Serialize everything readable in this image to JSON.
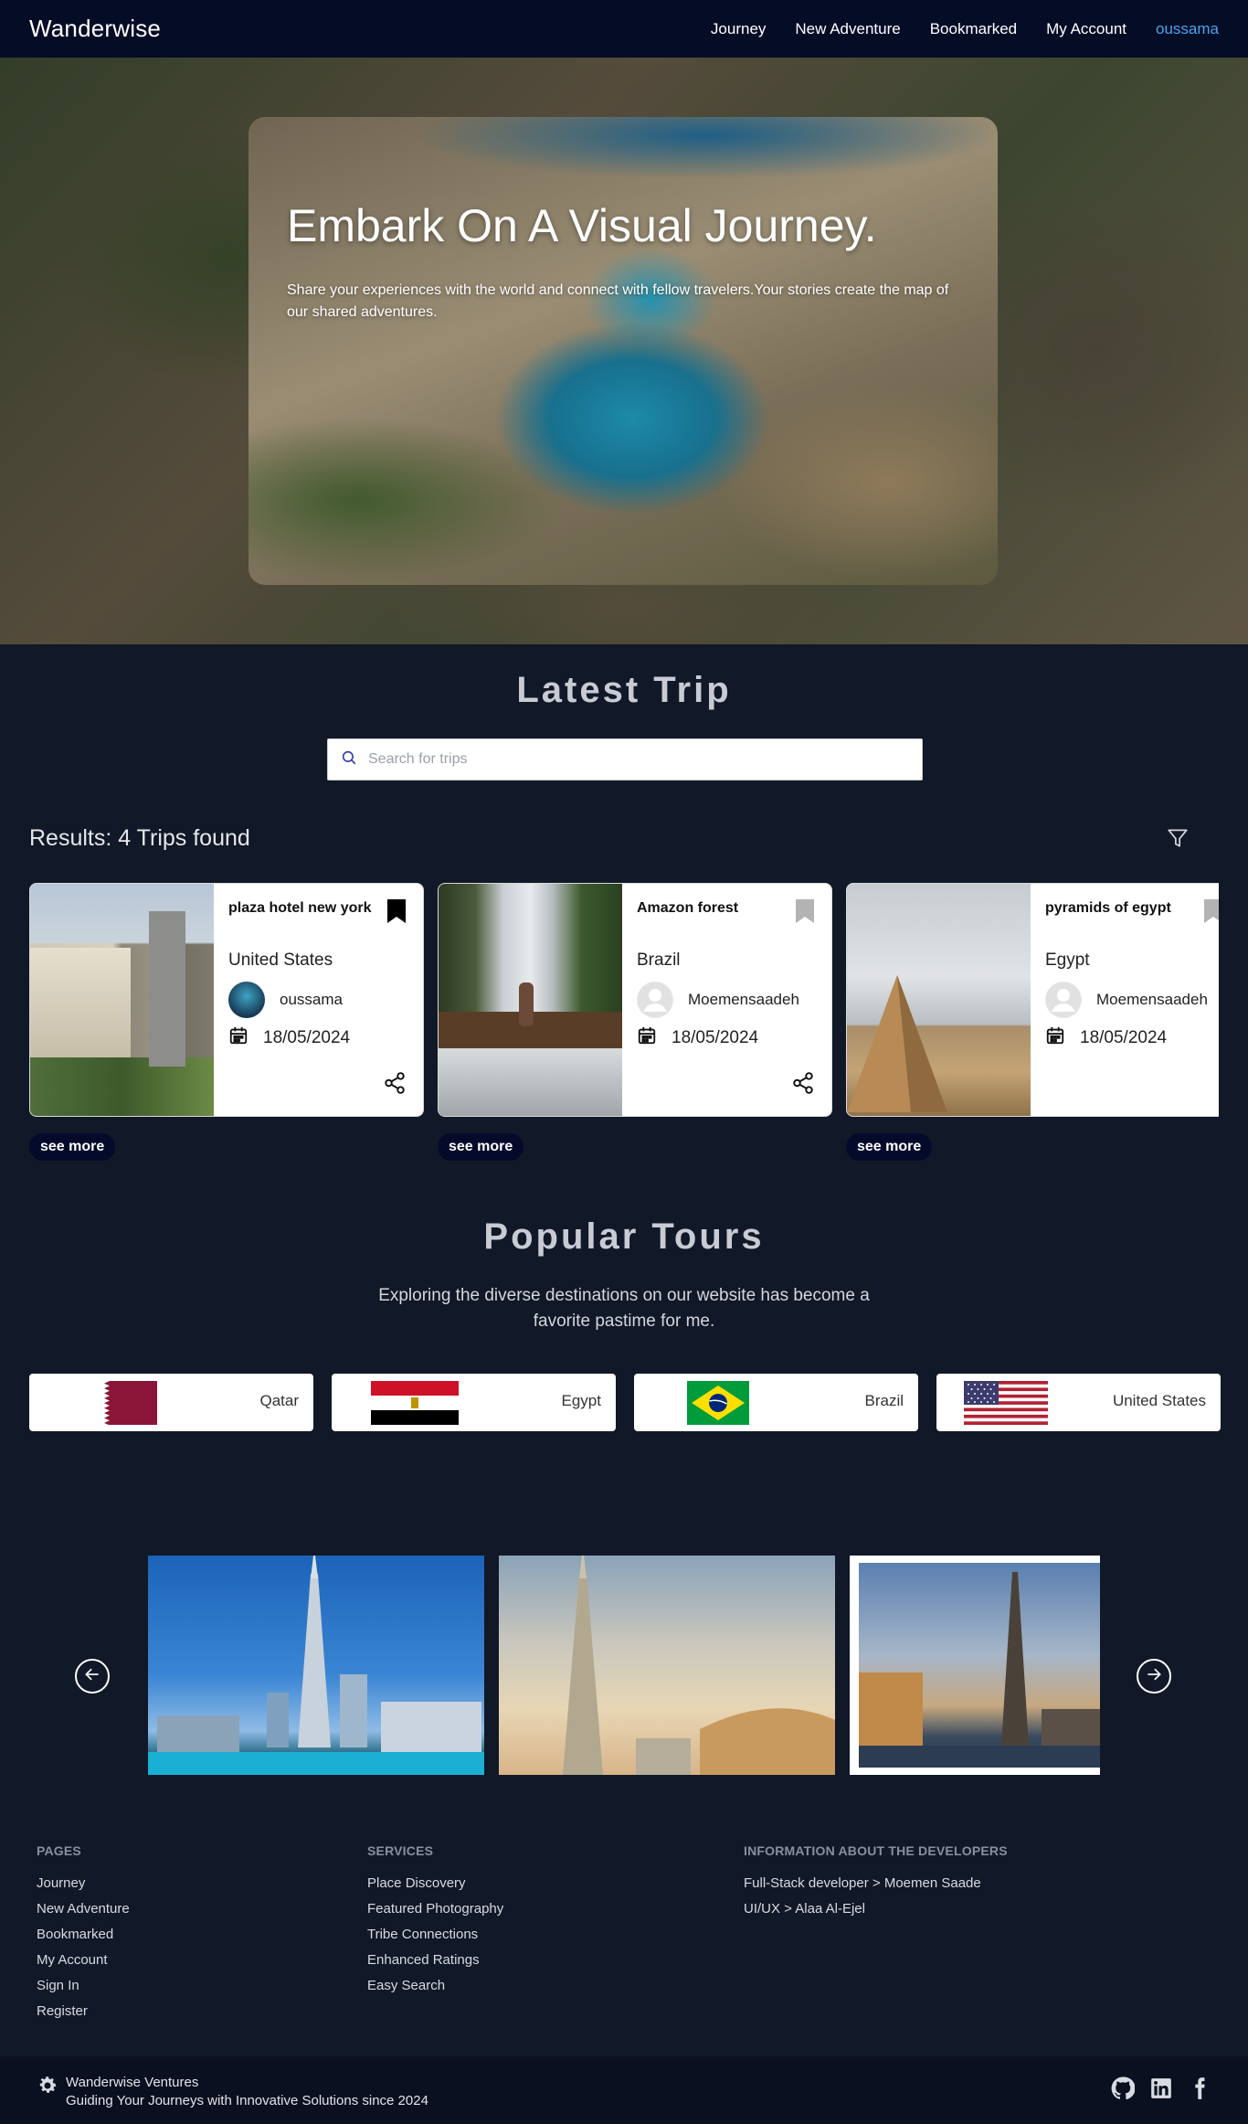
{
  "nav": {
    "brand": "Wanderwise",
    "links": [
      "Journey",
      "New Adventure",
      "Bookmarked",
      "My Account"
    ],
    "user": "oussama"
  },
  "hero": {
    "title": "Embark On A Visual Journey.",
    "text": "Share your experiences with the world and connect with fellow travelers.Your stories create the map of our shared adventures."
  },
  "latest": {
    "title": "Latest Trip",
    "search_placeholder": "Search for trips",
    "results": "Results: 4 Trips found",
    "see_more": "see more",
    "cards": [
      {
        "title": "plaza hotel new york",
        "country": "United States",
        "user": "oussama",
        "date": "18/05/2024",
        "bookmarked": true
      },
      {
        "title": "Amazon forest",
        "country": "Brazil",
        "user": "Moemensaadeh",
        "date": "18/05/2024",
        "bookmarked": false
      },
      {
        "title": "pyramids of egypt",
        "country": "Egypt",
        "user": "Moemensaadeh",
        "date": "18/05/2024",
        "bookmarked": false
      }
    ]
  },
  "popular": {
    "title": "Popular Tours",
    "text": "Exploring the diverse destinations on our website has become a favorite pastime for me.",
    "countries": [
      "Qatar",
      "Egypt",
      "Brazil",
      "United States"
    ]
  },
  "footer": {
    "pages_head": "PAGES",
    "pages": [
      "Journey",
      "New Adventure",
      "Bookmarked",
      "My Account",
      "Sign In",
      "Register"
    ],
    "services_head": "SERVICES",
    "services": [
      "Place Discovery",
      "Featured Photography",
      "Tribe Connections",
      "Enhanced Ratings",
      "Easy Search"
    ],
    "dev_head": "INFORMATION ABOUT THE DEVELOPERS",
    "devs": [
      "Full-Stack developer  > Moemen Saade",
      "UI/UX > Alaa Al-Ejel"
    ],
    "company": "Wanderwise Ventures",
    "tagline": "Guiding Your Journeys with Innovative Solutions since 2024"
  },
  "colors": {
    "nav_bg": "#050c26",
    "page_bg": "#111827",
    "accent": "#4aa3f0",
    "button_bg": "#030a2a"
  }
}
